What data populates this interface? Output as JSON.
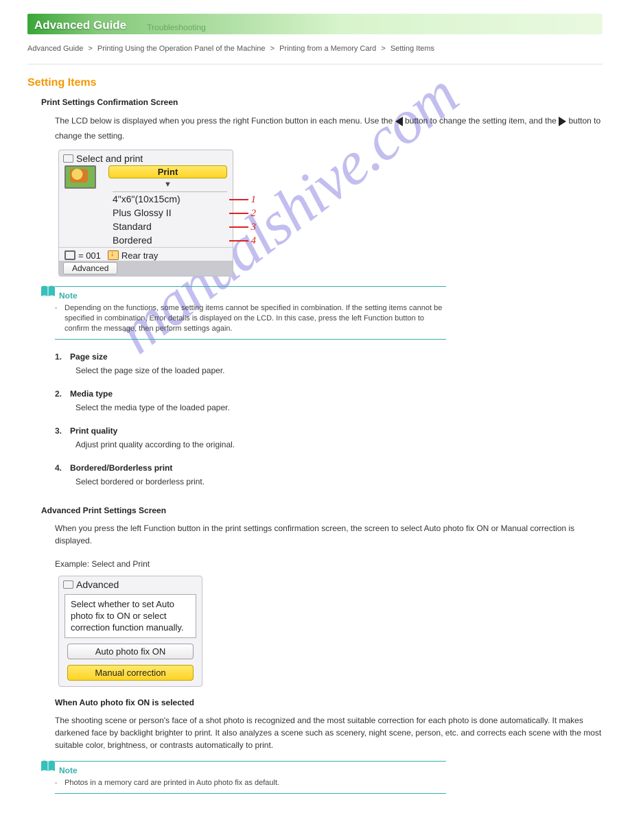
{
  "ribbon": {
    "main": "Advanced Guide",
    "secondary": "Troubleshooting"
  },
  "breadcrumbs": [
    "Advanced Guide",
    "Printing Using the Operation Panel of the Machine",
    "Printing from a Memory Card",
    "Setting Items"
  ],
  "page_title": "Setting Items",
  "section_heading": "Print Settings Confirmation Screen",
  "intro_line_1": "The LCD below is displayed when you press the right Function button in each menu. Use the",
  "intro_line_2": "button to change the setting item, and the",
  "intro_line_3": "button to change the setting.",
  "lcd1": {
    "title": "Select and print",
    "print_btn": "Print",
    "options": [
      "4\"x6\"(10x15cm)",
      "Plus Glossy II",
      "Standard",
      "Bordered"
    ],
    "callouts": [
      "1",
      "2",
      "3",
      "4"
    ],
    "count": "= 001",
    "tray": "Rear tray",
    "advanced_btn": "Advanced"
  },
  "note1": {
    "head": "Note",
    "body": "Depending on the functions, some setting items cannot be specified in combination. If the setting items cannot be specified in combination, Error details is displayed on the LCD. In this case, press the left Function button to confirm the message, then perform settings again."
  },
  "items": [
    {
      "num": "1.",
      "title": "Page size",
      "desc": "Select the page size of the loaded paper."
    },
    {
      "num": "2.",
      "title": "Media type",
      "desc": "Select the media type of the loaded paper."
    },
    {
      "num": "3.",
      "title": "Print quality",
      "desc": "Adjust print quality according to the original."
    },
    {
      "num": "4.",
      "title": "Bordered/Borderless print",
      "desc": "Select bordered or borderless print."
    }
  ],
  "advanced_section": {
    "heading": "Advanced Print Settings Screen",
    "line1": "When you press the left Function button in the print settings confirmation screen, the screen to select Auto photo fix ON or Manual correction is displayed.",
    "ex": "Example: Select and Print",
    "lcd2": {
      "title": "Advanced",
      "prompt": "Select whether to set Auto photo fix to ON or select correction function manually.",
      "btn_auto": "Auto photo fix ON",
      "btn_manual": "Manual correction"
    },
    "after": "When Auto photo fix ON is selected",
    "after_desc": "The shooting scene or person's face of a shot photo is recognized and the most suitable correction for each photo is done automatically. It makes darkened face by backlight brighter to print. It also analyzes a scene such as scenery, night scene, person, etc. and corrects each scene with the most suitable color, brightness, or contrasts automatically to print.",
    "note2_head": "Note",
    "note2_body": "Photos in a memory card are printed in Auto photo fix as default."
  }
}
